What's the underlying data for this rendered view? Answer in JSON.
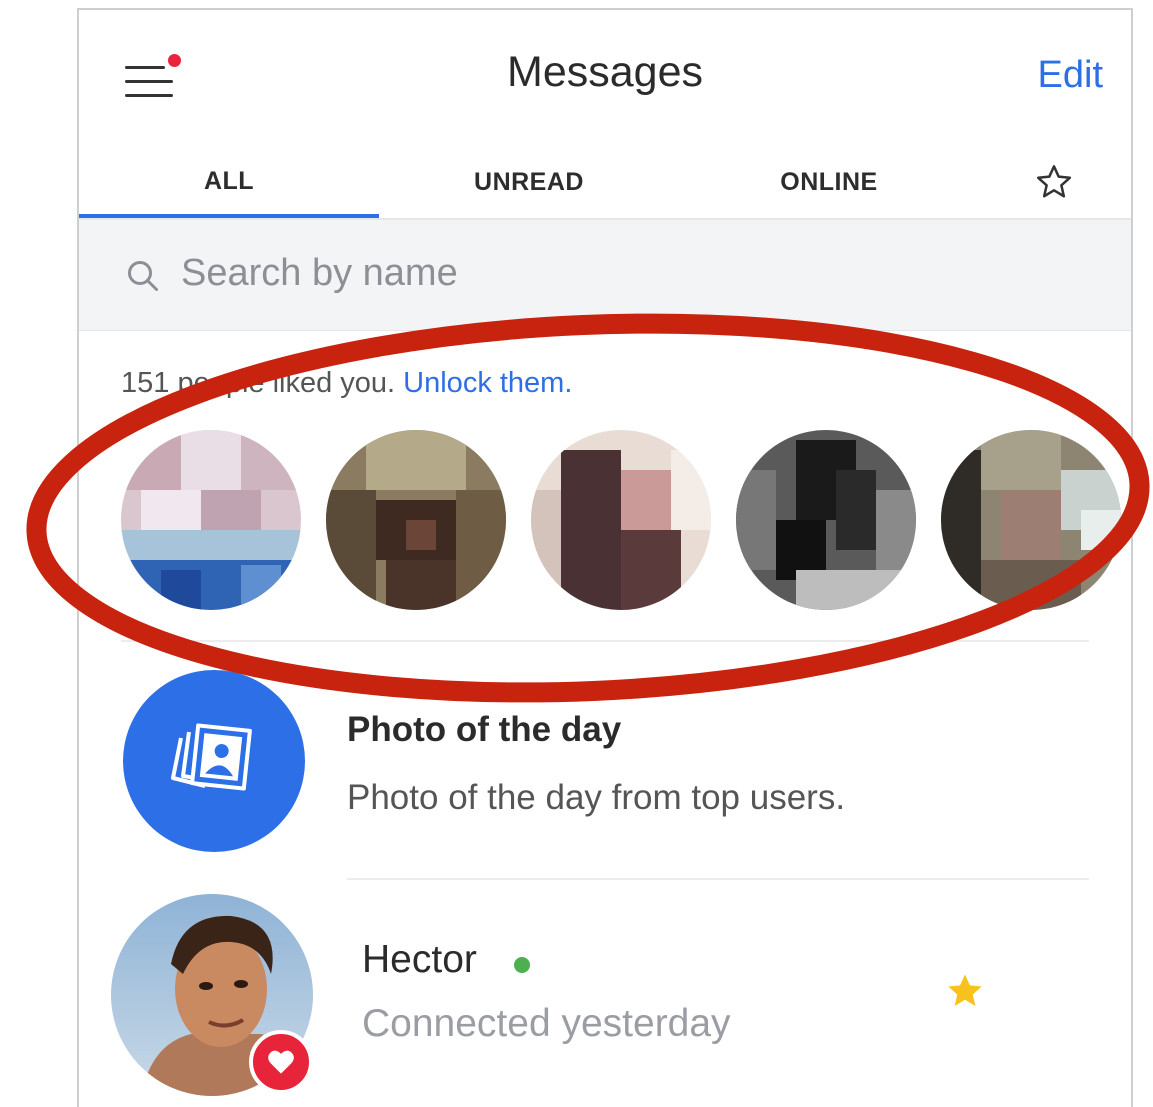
{
  "header": {
    "title": "Messages",
    "edit_label": "Edit",
    "menu_has_notification": true
  },
  "tabs": [
    {
      "label": "ALL",
      "active": true
    },
    {
      "label": "UNREAD",
      "active": false
    },
    {
      "label": "ONLINE",
      "active": false
    },
    {
      "icon": "star-outline-icon",
      "active": false
    }
  ],
  "search": {
    "placeholder": "Search by name"
  },
  "likes": {
    "text": "151 people liked you.",
    "link": "Unlock them.",
    "blurred_avatar_count": 5
  },
  "photo_of_day": {
    "title": "Photo of the day",
    "subtitle": "Photo of the day from top users.",
    "icon": "photos-stack-icon"
  },
  "contacts": [
    {
      "name": "Hector",
      "status": "Connected yesterday",
      "online": true,
      "favorite": true,
      "badge": "heart-icon"
    }
  ],
  "colors": {
    "accent": "#2d6fe6",
    "notification": "#e8243b",
    "online": "#4cb050",
    "favorite": "#f7c21c",
    "highlight": "#c8230f"
  }
}
